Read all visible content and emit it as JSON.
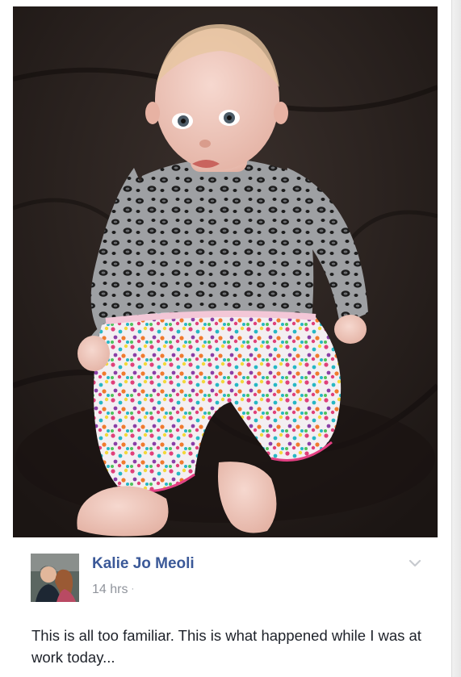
{
  "post": {
    "author": "Kalie Jo Meoli",
    "timestamp": "14 hrs",
    "separator": "·",
    "text": "This is all too familiar. This is what happened while I was at work today...",
    "icons": {
      "menu": "chevron-down-icon"
    }
  },
  "colors": {
    "author_link": "#3b5998",
    "meta_text": "#90949c",
    "body_text": "#1d2129"
  }
}
